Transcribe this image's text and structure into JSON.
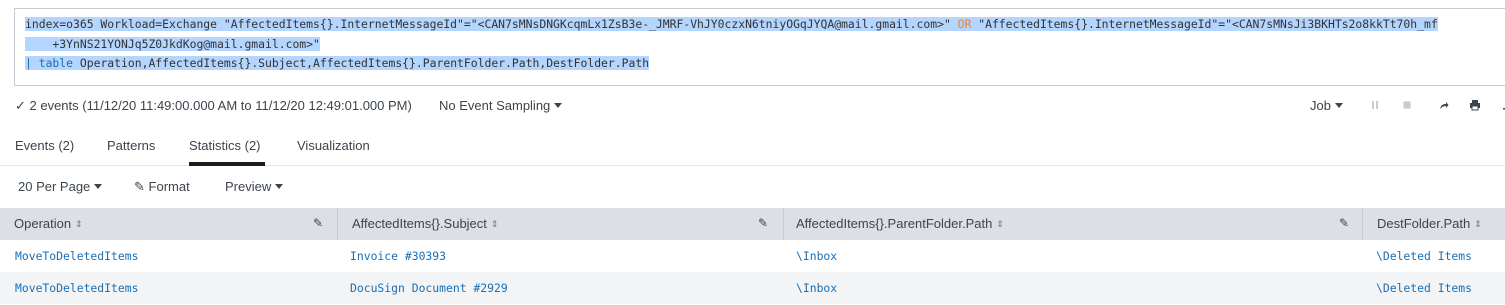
{
  "search": {
    "line1_pre": "index=o365 Workload=Exchange \"AffectedItems{}.InternetMessageId\"=\"<CAN7sMNsDNGKcqmLx1ZsB3e-_JMRF-VhJY0czxN6tniyOGqJYQA@mail.gmail.com>\" ",
    "line1_or": "OR",
    "line1_post": " \"AffectedItems{}.InternetMessageId\"=\"<CAN7sMNsJi3BKHTs2o8kkTt70h_mf",
    "line2": "    +3YnNS21YONJq5Z0JkdKog@mail.gmail.com>\"",
    "line3_pipe": "| ",
    "line3_cmd": "table",
    "line3_rest": " Operation,AffectedItems{}.Subject,AffectedItems{}.ParentFolder.Path,DestFolder.Path"
  },
  "status": {
    "events_text": "✓ 2 events (11/12/20 11:49:00.000 AM to 11/12/20 12:49:01.000 PM)",
    "sampling_label": "No Event Sampling",
    "job_label": "Job"
  },
  "tabs": [
    {
      "label": "Events (2)"
    },
    {
      "label": "Patterns"
    },
    {
      "label": "Statistics (2)"
    },
    {
      "label": "Visualization"
    }
  ],
  "controls": {
    "per_page": "20 Per Page",
    "format": "Format",
    "preview": "Preview"
  },
  "table": {
    "columns": [
      {
        "label": "Operation"
      },
      {
        "label": "AffectedItems{}.Subject"
      },
      {
        "label": "AffectedItems{}.ParentFolder.Path"
      },
      {
        "label": "DestFolder.Path"
      }
    ],
    "rows": [
      [
        "MoveToDeletedItems",
        "Invoice #30393",
        "\\Inbox",
        "\\Deleted Items"
      ],
      [
        "MoveToDeletedItems",
        "DocuSign Document #2929",
        "\\Inbox",
        "\\Deleted Items"
      ]
    ]
  },
  "icons": {
    "check": "check-icon",
    "pause": "pause-icon",
    "stop": "stop-icon",
    "share": "share-icon",
    "print": "print-icon",
    "export": "export-icon",
    "pencil": "pencil-icon",
    "sort": "sort-icon"
  }
}
